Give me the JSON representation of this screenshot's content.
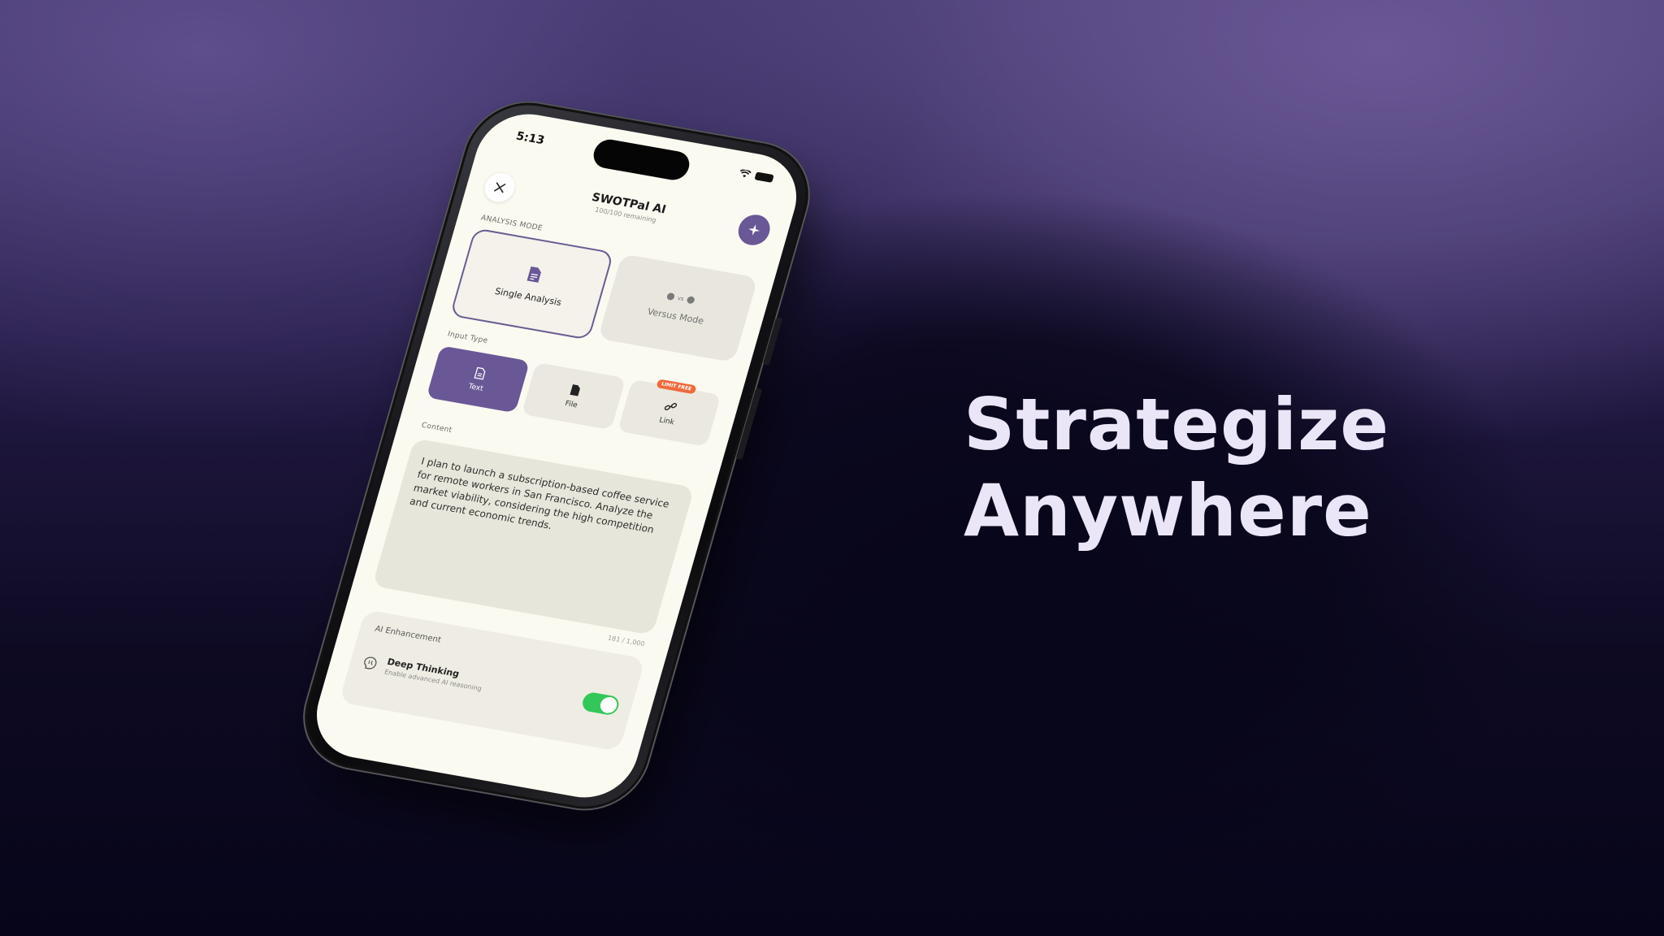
{
  "headline": {
    "line1": "Strategize",
    "line2": "Anywhere"
  },
  "phone": {
    "status_bar": {
      "time": "5:13"
    },
    "header": {
      "title": "SWOTPal AI",
      "subtitle": "100/100 remaining",
      "close_icon": "close-icon",
      "magic_icon": "sparkles-icon"
    },
    "analysis_mode": {
      "label": "ANALYSIS MODE",
      "options": [
        {
          "label": "Single Analysis",
          "icon": "document-icon",
          "selected": true
        },
        {
          "label": "Versus Mode",
          "icon": "versus-icon",
          "vs_text": "vs",
          "selected": false
        }
      ]
    },
    "input_type": {
      "label": "Input Type",
      "tabs": [
        {
          "label": "Text",
          "icon": "text-document-icon",
          "active": true
        },
        {
          "label": "File",
          "icon": "file-icon",
          "active": false
        },
        {
          "label": "Link",
          "icon": "link-icon",
          "active": false,
          "badge": "LIMIT FREE"
        }
      ]
    },
    "content": {
      "label": "Content",
      "value": "I plan to launch a subscription-based coffee service for remote workers in San Francisco. Analyze the market viability, considering the high competition and current economic trends.",
      "char_count": "181 / 1,000"
    },
    "ai_enhancement": {
      "title": "AI Enhancement",
      "option_name": "Deep Thinking",
      "option_desc": "Enable advanced AI reasoning",
      "enabled": true,
      "icon": "brain-icon"
    }
  },
  "colors": {
    "accent": "#6a5796",
    "toggle_on": "#33c759",
    "badge": "#ef6a3c",
    "screen_bg": "#fbfaf1"
  }
}
